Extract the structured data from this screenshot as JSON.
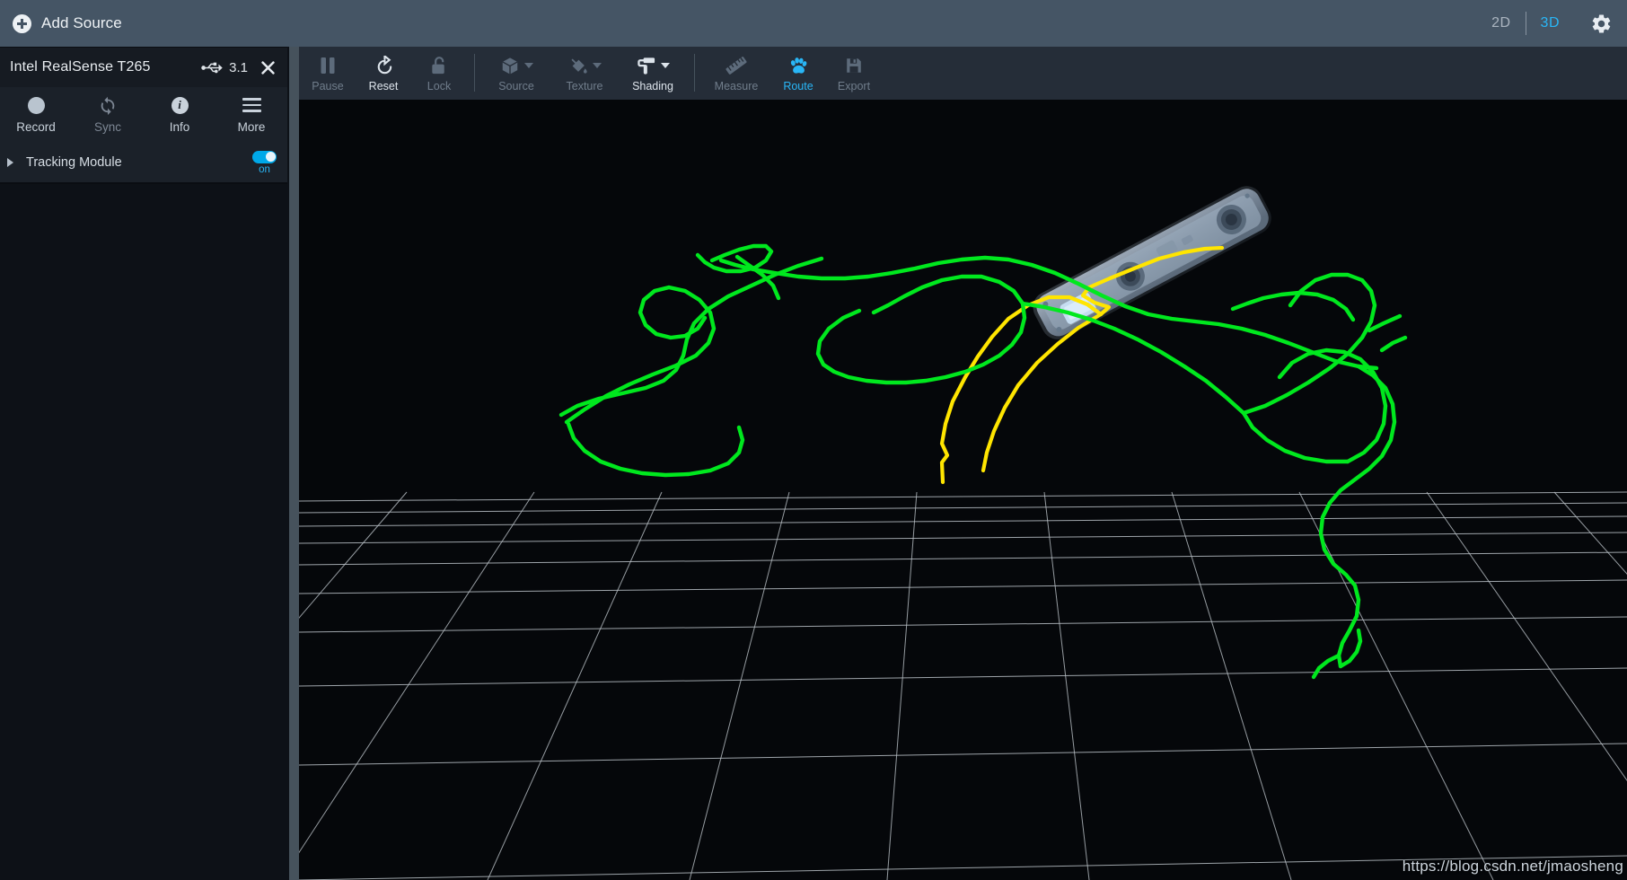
{
  "topbar": {
    "add_source_label": "Add Source",
    "add_source_icon": "plus-circle-icon",
    "view_2d_label": "2D",
    "view_3d_label": "3D",
    "view_active": "3D",
    "settings_icon": "gear-icon"
  },
  "sidebar": {
    "device": {
      "name": "Intel RealSense T265",
      "usb_icon": "usb-icon",
      "usb_version": "3.1",
      "close_icon": "close-icon"
    },
    "actions": [
      {
        "label": "Record",
        "icon": "record-circle-icon",
        "enabled": true
      },
      {
        "label": "Sync",
        "icon": "sync-arrows-icon",
        "enabled": false
      },
      {
        "label": "Info",
        "icon": "info-circle-icon",
        "enabled": true
      },
      {
        "label": "More",
        "icon": "hamburger-menu-icon",
        "enabled": true
      }
    ],
    "modules": [
      {
        "label": "Tracking Module",
        "expand_icon": "caret-right-icon",
        "toggle_state": "on",
        "toggle_label": "on"
      }
    ]
  },
  "viewport_toolbar": {
    "items": [
      {
        "label": "Pause",
        "icon": "pause-icon",
        "state": "disabled",
        "dropdown": false
      },
      {
        "label": "Reset",
        "icon": "reset-arrow-icon",
        "state": "enabled",
        "dropdown": false
      },
      {
        "label": "Lock",
        "icon": "lock-open-icon",
        "state": "disabled",
        "dropdown": false
      },
      {
        "label": "Source",
        "icon": "cube-icon",
        "state": "disabled",
        "dropdown": true
      },
      {
        "label": "Texture",
        "icon": "paint-bucket-icon",
        "state": "disabled",
        "dropdown": true
      },
      {
        "label": "Shading",
        "icon": "paint-roller-icon",
        "state": "enabled",
        "dropdown": true
      },
      {
        "label": "Measure",
        "icon": "ruler-icon",
        "state": "disabled",
        "dropdown": false
      },
      {
        "label": "Route",
        "icon": "paw-print-icon",
        "state": "active",
        "dropdown": false
      },
      {
        "label": "Export",
        "icon": "floppy-save-icon",
        "state": "disabled",
        "dropdown": false
      }
    ]
  },
  "viewport": {
    "watermark": "https://blog.csdn.net/jmaosheng",
    "device_model": "Intel RealSense T265 tracking camera",
    "trajectory_green_color": "#00E81E",
    "trajectory_yellow_color": "#FFE500",
    "grid_color": "#b9c0c6",
    "background_color": "#05070a"
  },
  "colors": {
    "topbar_bg": "#455565",
    "panel_bg": "#1b2129",
    "panel_head_bg": "#161b22",
    "toolbar_bg": "#252d38",
    "accent_blue": "#29b6f6",
    "toggle_blue": "#00a8e8",
    "text_primary": "#e9edf1",
    "text_dim": "#7d8794"
  }
}
